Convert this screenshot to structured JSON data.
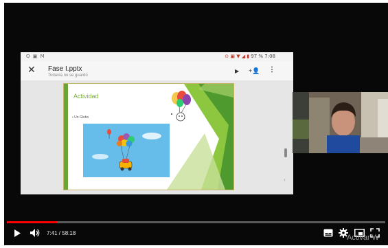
{
  "status_bar": {
    "left_icons": "O ▣ M",
    "right_text": "97 % 7:08"
  },
  "app_bar": {
    "close_glyph": "✕",
    "file_name": "Fase I.pptx",
    "save_status": "Todavía no se guardó",
    "play_glyph": "▶",
    "share_glyph": "+👤",
    "more_glyph": "⋮"
  },
  "slide": {
    "title": "Actividad",
    "bullet": "• Un Globo"
  },
  "player": {
    "current_time": "7:41",
    "separator": " / ",
    "duration": "58:18",
    "progress_fraction": 0.132,
    "accent_color": "#ff0000"
  },
  "watermark": "Activar W",
  "icons": [
    "close-icon",
    "play-icon",
    "add-person-icon",
    "more-vert-icon",
    "volume-icon",
    "subtitles-icon",
    "gear-icon",
    "miniplayer-icon",
    "fullscreen-icon"
  ]
}
